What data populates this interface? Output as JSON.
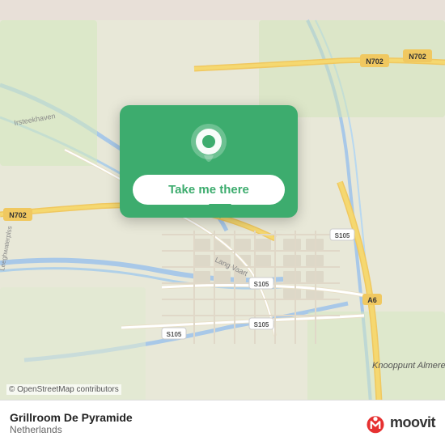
{
  "map": {
    "background_color": "#e8f0d8",
    "copyright": "© OpenStreetMap contributors"
  },
  "action_card": {
    "button_label": "Take me there"
  },
  "bottom_bar": {
    "place_name": "Grillroom De Pyramide",
    "place_country": "Netherlands"
  },
  "moovit": {
    "logo_text": "moovit"
  },
  "road_labels": {
    "n702_top": "N702",
    "n702_left": "N702",
    "n702_right": "N702",
    "s105_1": "S105",
    "s105_2": "S105",
    "s105_3": "S105",
    "a6": "A6",
    "lang_vaart": "Lang Vaart",
    "lang_vaart2": "Lang Vaart",
    "knooppunt": "Knooppunt Almere",
    "irsteek": "Irsteekhaven",
    "leeghwater": "Leeghwaterplss"
  }
}
